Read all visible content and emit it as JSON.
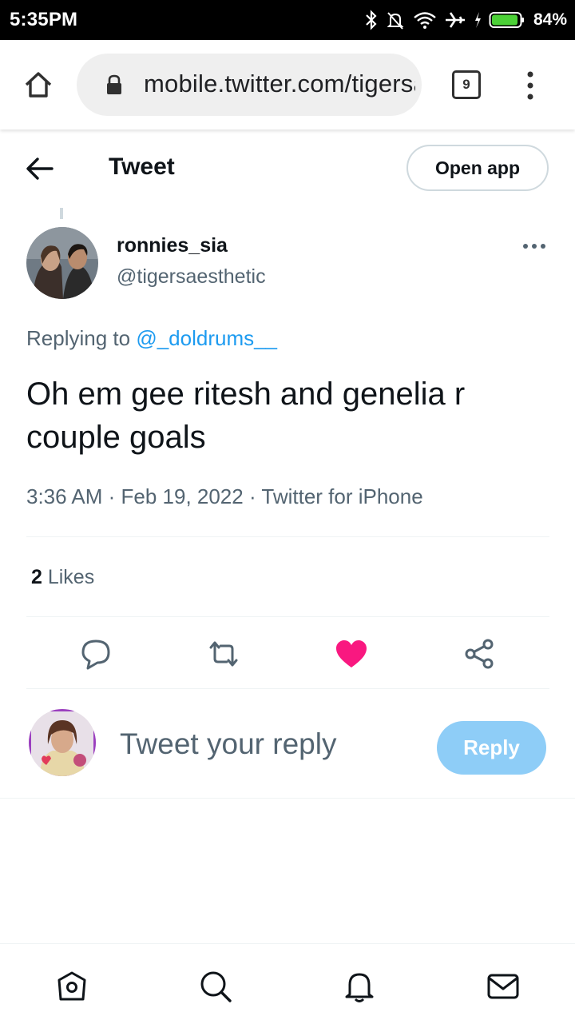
{
  "status_bar": {
    "time": "5:35PM",
    "battery_percent": "84%",
    "icons": [
      "bluetooth-icon",
      "mute-icon",
      "wifi-icon",
      "airplane-icon",
      "charging-icon",
      "battery-icon"
    ]
  },
  "browser": {
    "url": "mobile.twitter.com/tigersaesthetic/status",
    "tab_count": "9"
  },
  "header": {
    "title": "Tweet",
    "open_app_label": "Open app"
  },
  "tweet": {
    "author_name": "ronnies_sia",
    "author_handle": "@tigersaesthetic",
    "replying_to_prefix": "Replying to ",
    "replying_to_handle": "@_doldrums__",
    "text": "Oh em gee ritesh and genelia r couple goals",
    "meta": "3:36 AM · Feb 19, 2022 · Twitter for iPhone",
    "likes_count": "2",
    "likes_label": " Likes",
    "liked": true
  },
  "reply_box": {
    "placeholder": "Tweet your reply",
    "button_label": "Reply"
  },
  "bottom_nav": {
    "items": [
      "home-icon",
      "search-icon",
      "notifications-icon",
      "messages-icon"
    ]
  },
  "colors": {
    "accent": "#1d9bf0",
    "like": "#f91880",
    "reply_button": "#8ecdf7",
    "secondary_text": "#536471"
  }
}
